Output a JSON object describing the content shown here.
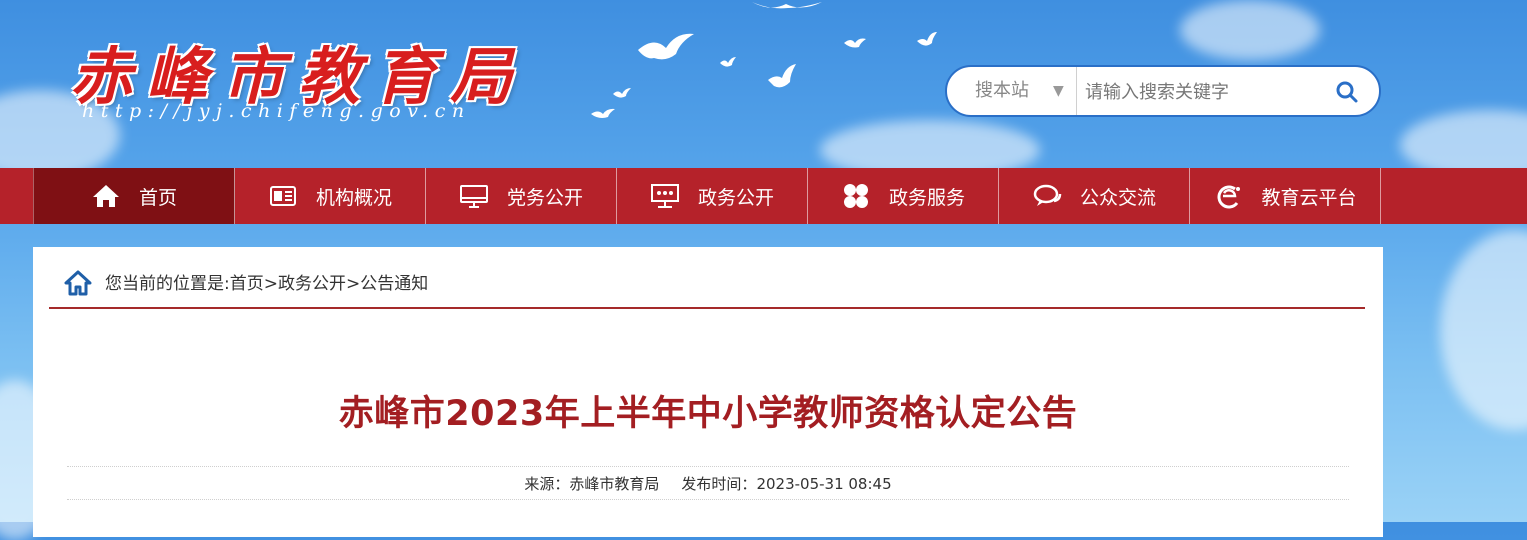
{
  "header": {
    "site_title": "赤峰市教育局",
    "site_url": "http://jyj.chifeng.gov.cn",
    "search": {
      "scope": "搜本站",
      "placeholder": "请输入搜索关键字"
    }
  },
  "nav": {
    "items": [
      {
        "label": "首页",
        "icon": "home-icon"
      },
      {
        "label": "机构概况",
        "icon": "newspaper-icon"
      },
      {
        "label": "党务公开",
        "icon": "monitor-icon"
      },
      {
        "label": "政务公开",
        "icon": "presentation-icon"
      },
      {
        "label": "政务服务",
        "icon": "grid-icon"
      },
      {
        "label": "公众交流",
        "icon": "chat-icon"
      },
      {
        "label": "教育云平台",
        "icon": "cloud-e-icon"
      }
    ]
  },
  "breadcrumb": {
    "text": "您当前的位置是:首页>政务公开>公告通知"
  },
  "article": {
    "title": "赤峰市2023年上半年中小学教师资格认定公告",
    "source_label": "来源：",
    "source": "赤峰市教育局",
    "date_label": "发布时间：",
    "date": "2023-05-31 08:45"
  },
  "colors": {
    "nav_bg": "#b5222a",
    "nav_active": "#7f1014",
    "title_red": "#a31e22",
    "logo_red": "#d81e1e",
    "search_border": "#2a6fc7"
  }
}
